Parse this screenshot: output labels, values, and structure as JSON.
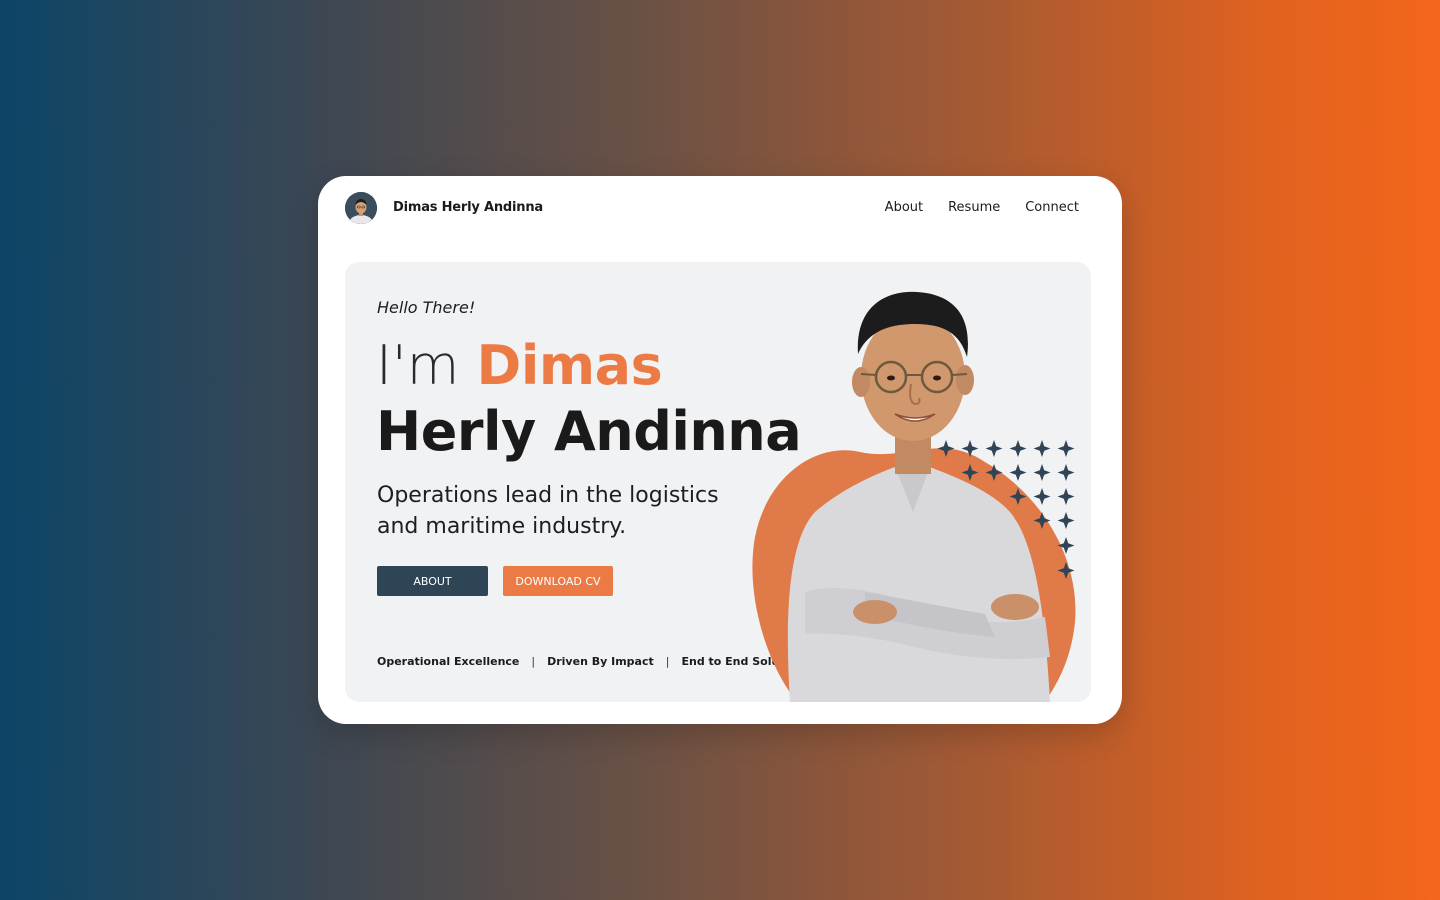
{
  "header": {
    "brand_name": "Dimas Herly Andinna",
    "nav": [
      {
        "label": "About"
      },
      {
        "label": "Resume"
      },
      {
        "label": "Connect"
      }
    ]
  },
  "hero": {
    "greeting": "Hello There!",
    "headline_prefix": "I'm ",
    "headline_name": "Dimas",
    "headline_line2": "Herly Andinna",
    "subtitle": "Operations lead in the logistics and maritime industry.",
    "buttons": {
      "about": "ABOUT",
      "download_cv": "DOWNLOAD CV"
    },
    "tags": [
      "Operational Excellence",
      "Driven By Impact",
      "End to End Solutions"
    ],
    "tag_separator": "|"
  },
  "colors": {
    "accent": "#ec7a44",
    "navy": "#2e4556",
    "hero_bg": "#f1f2f4"
  },
  "icons": [
    "avatar-photo",
    "sparkle-star-icon",
    "portrait-photo"
  ]
}
